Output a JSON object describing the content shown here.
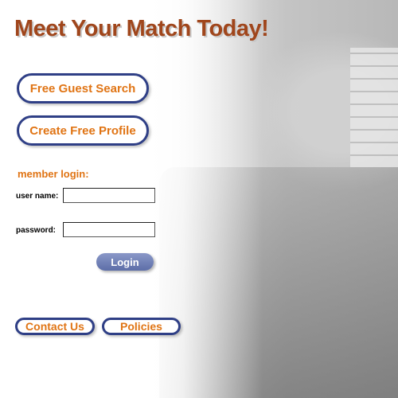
{
  "header": {
    "title": "Meet Your Match Today!"
  },
  "actions": {
    "guest_search_label": "Free Guest Search",
    "create_profile_label": "Create Free Profile"
  },
  "login": {
    "heading": "member login:",
    "username_label": "user name:",
    "username_value": "",
    "password_label": "password:",
    "password_value": "",
    "submit_label": "Login"
  },
  "footer": {
    "contact_label": "Contact Us",
    "policies_label": "Policies"
  },
  "hero_image": {
    "description_icon": "couple-photo"
  },
  "colors": {
    "title": "#a0461c",
    "accent_orange": "#e07414",
    "pill_border": "#2f3f86",
    "login_button": "#6b7bb3"
  }
}
